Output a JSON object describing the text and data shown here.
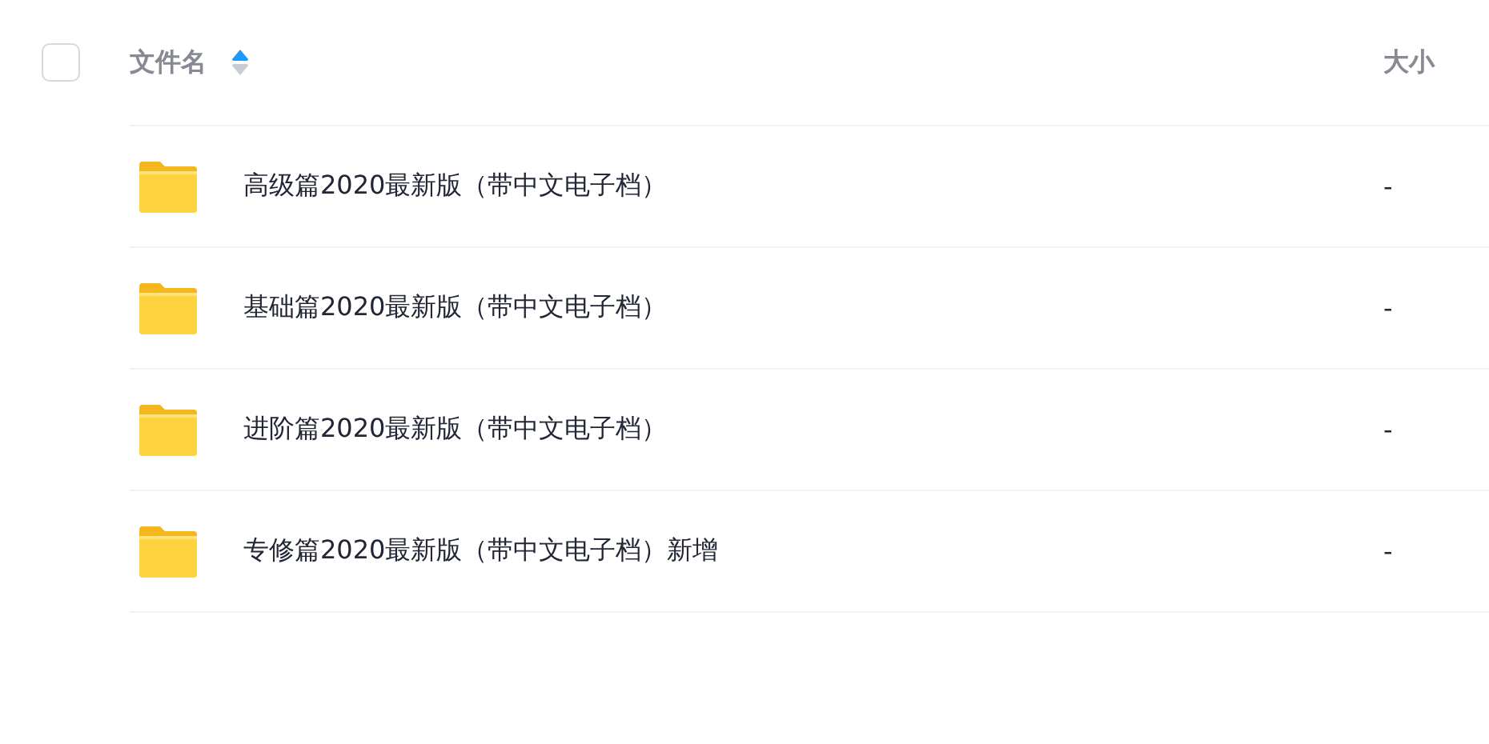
{
  "header": {
    "select_all": {
      "checked": false
    },
    "columns": [
      {
        "label": "文件名",
        "sort_ascending": true
      },
      {
        "label": "大小"
      }
    ]
  },
  "rows": [
    {
      "name": "高级篇2020最新版（带中文电子档）",
      "size": "-"
    },
    {
      "name": "基础篇2020最新版（带中文电子档）",
      "size": "-"
    },
    {
      "name": "进阶篇2020最新版（带中文电子档）",
      "size": "-"
    },
    {
      "name": "专修篇2020最新版（带中文电子档）新增",
      "size": "-"
    }
  ]
}
